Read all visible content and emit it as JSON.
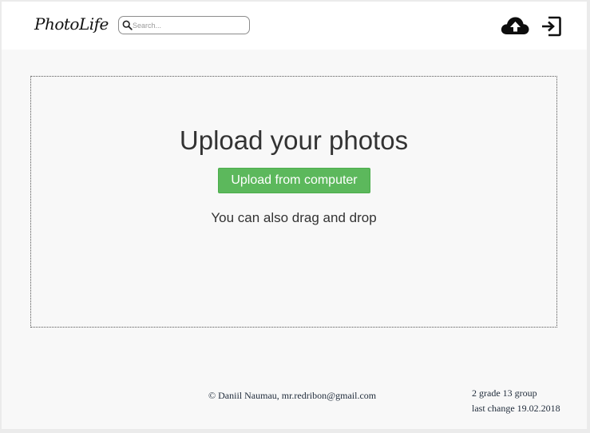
{
  "header": {
    "logo": "PhotoLife",
    "search": {
      "placeholder": "Search...",
      "value": "",
      "icon": "search-icon"
    },
    "actions": [
      {
        "name": "upload-cloud",
        "icon": "cloud-upload-icon"
      },
      {
        "name": "logout",
        "icon": "sign-out-icon"
      }
    ]
  },
  "dropzone": {
    "title": "Upload your photos",
    "button_label": "Upload from computer",
    "hint": "You can also drag and drop",
    "button_color": "#5cb85c"
  },
  "footer": {
    "copyright": "© Daniil Naumau, mr.redribon@gmail.com",
    "group": "2 grade 13 group",
    "last_change": "last change 19.02.2018"
  }
}
